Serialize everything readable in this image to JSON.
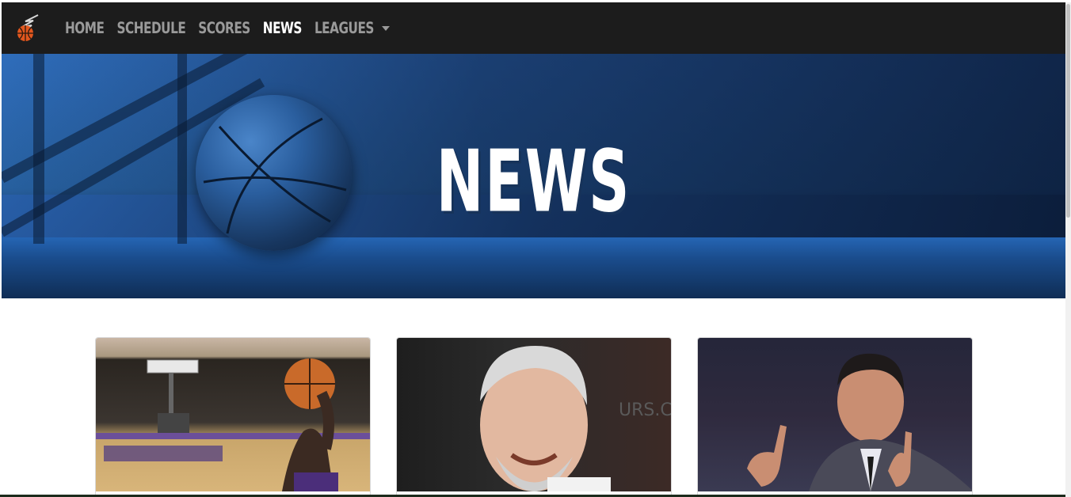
{
  "nav": {
    "items": [
      {
        "label": "HOME"
      },
      {
        "label": "SCHEDULE"
      },
      {
        "label": "SCORES"
      },
      {
        "label": "NEWS",
        "active": true
      },
      {
        "label": "LEAGUES",
        "dropdown": true
      }
    ],
    "logo_icon": "basketball-flame-logo"
  },
  "hero": {
    "title": "NEWS"
  },
  "cards": [
    {
      "image": "player-shooting-basketball-photo"
    },
    {
      "image": "smiling-coach-photo"
    },
    {
      "image": "coach-gesturing-photo"
    }
  ],
  "colors": {
    "navbar": "#1c1c1c",
    "nav_inactive": "#9a9a9a",
    "nav_active": "#ffffff",
    "hero_blue": "#2f6dbb"
  }
}
